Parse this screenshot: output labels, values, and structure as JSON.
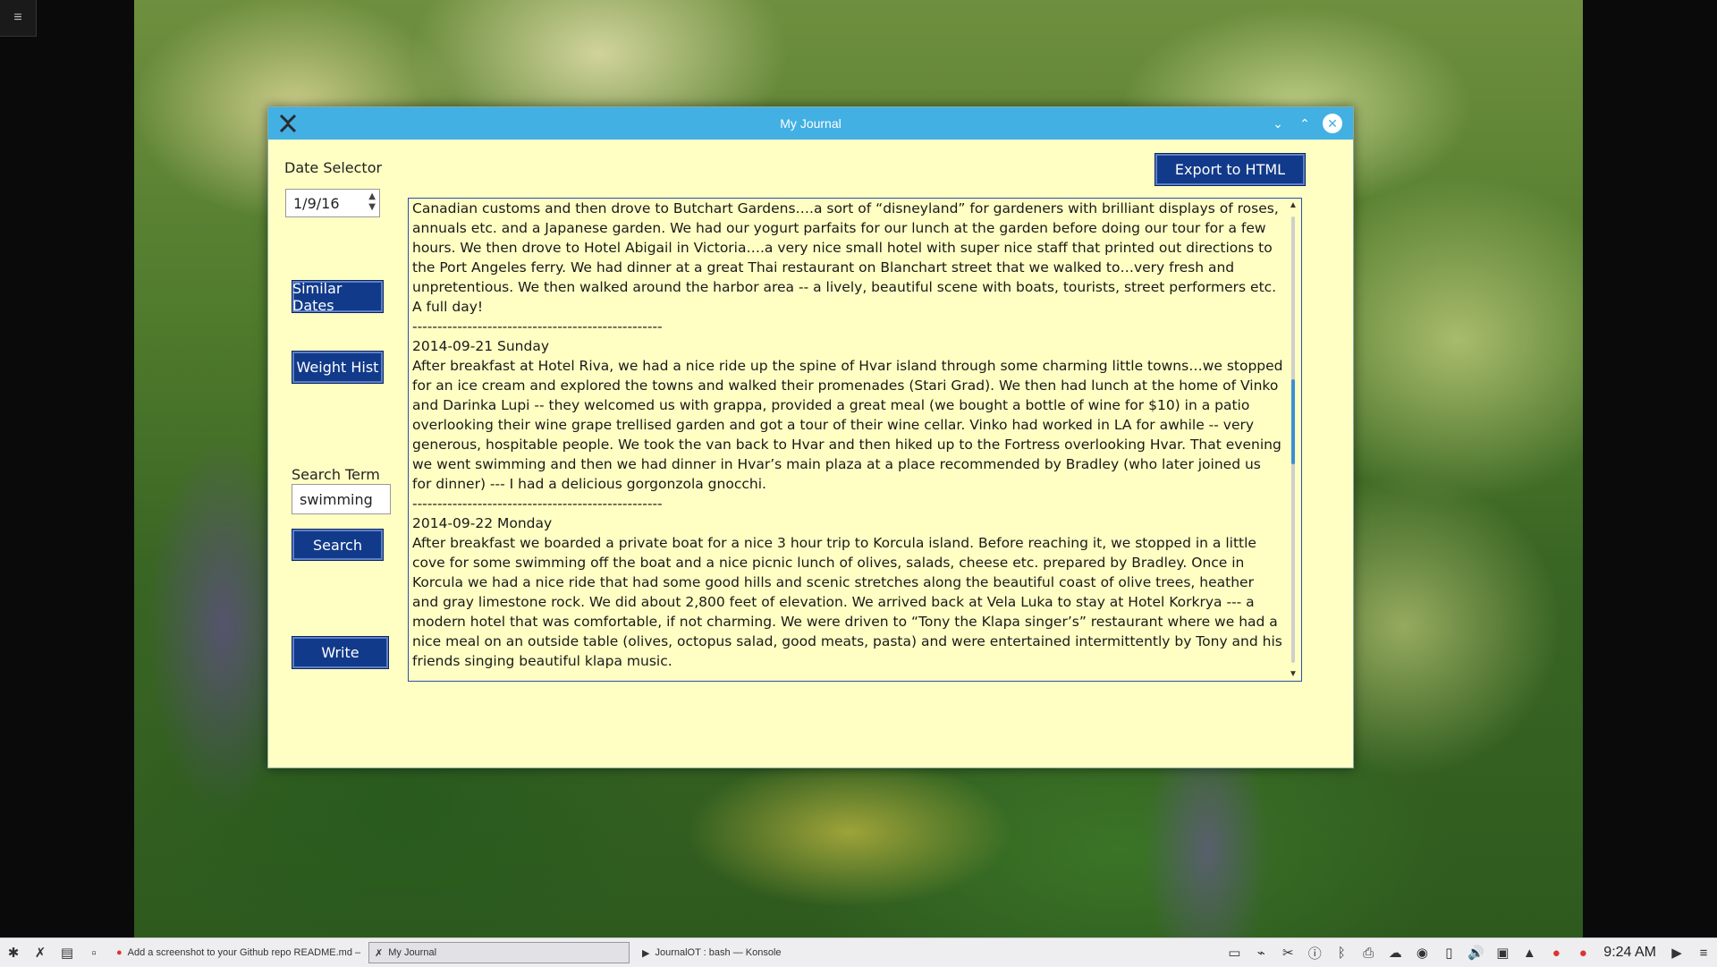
{
  "desktop": {
    "menu_icon": "≡"
  },
  "window": {
    "title": "My Journal",
    "minimize_glyph": "⌄",
    "maximize_glyph": "⌃",
    "close_glyph": "✕"
  },
  "app": {
    "date_selector_label": "Date Selector",
    "date_value": "1/9/16",
    "similar_dates_label": "Similar Dates",
    "weight_hist_label": "Weight Hist",
    "search_term_label": "Search Term",
    "search_value": "swimming",
    "search_button_label": "Search",
    "write_button_label": "Write",
    "export_button_label": "Export to HTML",
    "journal_text": "Canadian customs and then drove to Butchart Gardens….a sort of “disneyland” for gardeners with brilliant displays of roses, annuals etc. and a Japanese garden. We had our yogurt parfaits for our lunch at the garden before doing our tour for a few hours. We then drove to Hotel Abigail in Victoria….a very nice small hotel with super nice staff that printed out directions to the Port Angeles ferry. We had dinner at a great Thai restaurant on Blanchart street that we walked to…very fresh and unpretentious. We then walked around the harbor area -- a lively, beautiful scene with boats, tourists, street performers etc. A full day!\n--------------------------------------------------\n2014-09-21 Sunday\nAfter breakfast at Hotel Riva, we had a nice ride up the spine of Hvar island through some charming little towns…we stopped for an ice cream and explored the towns and walked their promenades (Stari Grad). We then had lunch at the home of Vinko and Darinka Lupi -- they welcomed us with grappa, provided a great meal (we bought a bottle of wine for $10) in a patio overlooking their wine grape trellised garden and got a tour of their wine cellar. Vinko had worked in LA for awhile -- very generous, hospitable people. We took the van back to Hvar and then hiked up to the Fortress overlooking Hvar. That evening we went swimming and then we had dinner in Hvar’s main plaza at a place recommended by Bradley (who later joined us for dinner) --- I had a delicious gorgonzola gnocchi.\n--------------------------------------------------\n2014-09-22 Monday\nAfter breakfast we boarded a private boat for a nice 3 hour trip to Korcula island. Before reaching it, we stopped in a little cove for some swimming off the boat and a nice picnic lunch of olives, salads, cheese etc. prepared by Bradley. Once in Korcula we had a nice ride that had some good hills and scenic stretches along the beautiful coast of olive trees, heather and gray limestone rock. We did about 2,800 feet of elevation. We arrived back at Vela Luka to stay at Hotel Korkrya --- a modern hotel that was comfortable, if not charming. We were driven to “Tony the Klapa singer’s” restaurant where we had a nice meal on an outside table (olives, octopus salad, good meats, pasta) and were entertained intermittently by Tony and his friends singing beautiful klapa music.",
    "scroll_position": 0.45
  },
  "taskbar": {
    "tasks": [
      {
        "label": "Add a screenshot to your Github repo README.md – Today I Learned... in Chr"
      },
      {
        "label": "My Journal"
      },
      {
        "label": "JournalOT : bash — Konsole"
      }
    ],
    "clock": "9:24 AM"
  }
}
